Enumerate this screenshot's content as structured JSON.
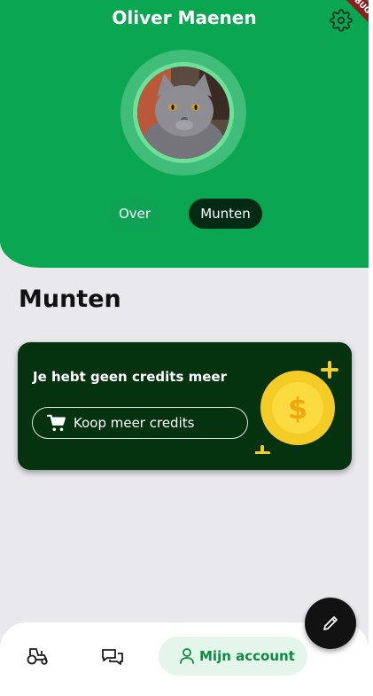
{
  "profile": {
    "name": "Oliver Maenen"
  },
  "debug_banner": "DEBUG",
  "tabs": [
    {
      "label": "Over",
      "selected": false
    },
    {
      "label": "Munten",
      "selected": true
    }
  ],
  "section": {
    "title": "Munten"
  },
  "credits_card": {
    "message": "Je hebt geen credits meer",
    "button_label": "Koop meer credits",
    "button_icon": "cart-icon",
    "graphic_icon": "coin-icon"
  },
  "fab": {
    "icon": "pencil-icon"
  },
  "bottom_nav": {
    "items": [
      {
        "icon": "tractor-icon",
        "label": "",
        "active": false
      },
      {
        "icon": "chat-icon",
        "label": "",
        "active": false
      },
      {
        "icon": "person-icon",
        "label": "Mijn account",
        "active": true
      }
    ]
  },
  "colors": {
    "header": "#0aa651",
    "card": "#05320f",
    "tab_selected": "#032b13",
    "coin": "#f5cc26",
    "accent": "#0d8a43",
    "background": "#e9e9ed"
  }
}
